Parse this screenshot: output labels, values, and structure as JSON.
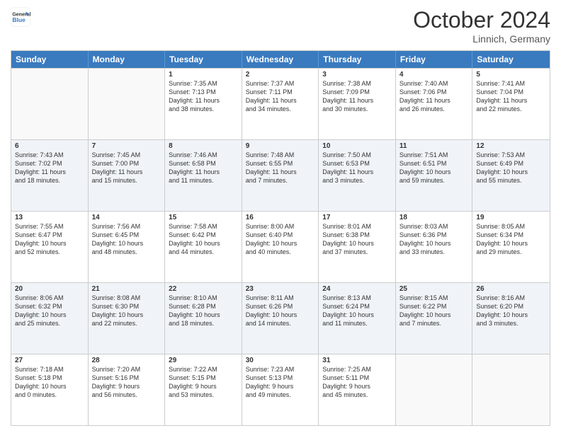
{
  "header": {
    "logo_general": "General",
    "logo_blue": "Blue",
    "month_title": "October 2024",
    "location": "Linnich, Germany"
  },
  "days_of_week": [
    "Sunday",
    "Monday",
    "Tuesday",
    "Wednesday",
    "Thursday",
    "Friday",
    "Saturday"
  ],
  "rows": [
    {
      "alt": false,
      "cells": [
        {
          "day": "",
          "info": ""
        },
        {
          "day": "",
          "info": ""
        },
        {
          "day": "1",
          "info": "Sunrise: 7:35 AM\nSunset: 7:13 PM\nDaylight: 11 hours\nand 38 minutes."
        },
        {
          "day": "2",
          "info": "Sunrise: 7:37 AM\nSunset: 7:11 PM\nDaylight: 11 hours\nand 34 minutes."
        },
        {
          "day": "3",
          "info": "Sunrise: 7:38 AM\nSunset: 7:09 PM\nDaylight: 11 hours\nand 30 minutes."
        },
        {
          "day": "4",
          "info": "Sunrise: 7:40 AM\nSunset: 7:06 PM\nDaylight: 11 hours\nand 26 minutes."
        },
        {
          "day": "5",
          "info": "Sunrise: 7:41 AM\nSunset: 7:04 PM\nDaylight: 11 hours\nand 22 minutes."
        }
      ]
    },
    {
      "alt": true,
      "cells": [
        {
          "day": "6",
          "info": "Sunrise: 7:43 AM\nSunset: 7:02 PM\nDaylight: 11 hours\nand 18 minutes."
        },
        {
          "day": "7",
          "info": "Sunrise: 7:45 AM\nSunset: 7:00 PM\nDaylight: 11 hours\nand 15 minutes."
        },
        {
          "day": "8",
          "info": "Sunrise: 7:46 AM\nSunset: 6:58 PM\nDaylight: 11 hours\nand 11 minutes."
        },
        {
          "day": "9",
          "info": "Sunrise: 7:48 AM\nSunset: 6:55 PM\nDaylight: 11 hours\nand 7 minutes."
        },
        {
          "day": "10",
          "info": "Sunrise: 7:50 AM\nSunset: 6:53 PM\nDaylight: 11 hours\nand 3 minutes."
        },
        {
          "day": "11",
          "info": "Sunrise: 7:51 AM\nSunset: 6:51 PM\nDaylight: 10 hours\nand 59 minutes."
        },
        {
          "day": "12",
          "info": "Sunrise: 7:53 AM\nSunset: 6:49 PM\nDaylight: 10 hours\nand 55 minutes."
        }
      ]
    },
    {
      "alt": false,
      "cells": [
        {
          "day": "13",
          "info": "Sunrise: 7:55 AM\nSunset: 6:47 PM\nDaylight: 10 hours\nand 52 minutes."
        },
        {
          "day": "14",
          "info": "Sunrise: 7:56 AM\nSunset: 6:45 PM\nDaylight: 10 hours\nand 48 minutes."
        },
        {
          "day": "15",
          "info": "Sunrise: 7:58 AM\nSunset: 6:42 PM\nDaylight: 10 hours\nand 44 minutes."
        },
        {
          "day": "16",
          "info": "Sunrise: 8:00 AM\nSunset: 6:40 PM\nDaylight: 10 hours\nand 40 minutes."
        },
        {
          "day": "17",
          "info": "Sunrise: 8:01 AM\nSunset: 6:38 PM\nDaylight: 10 hours\nand 37 minutes."
        },
        {
          "day": "18",
          "info": "Sunrise: 8:03 AM\nSunset: 6:36 PM\nDaylight: 10 hours\nand 33 minutes."
        },
        {
          "day": "19",
          "info": "Sunrise: 8:05 AM\nSunset: 6:34 PM\nDaylight: 10 hours\nand 29 minutes."
        }
      ]
    },
    {
      "alt": true,
      "cells": [
        {
          "day": "20",
          "info": "Sunrise: 8:06 AM\nSunset: 6:32 PM\nDaylight: 10 hours\nand 25 minutes."
        },
        {
          "day": "21",
          "info": "Sunrise: 8:08 AM\nSunset: 6:30 PM\nDaylight: 10 hours\nand 22 minutes."
        },
        {
          "day": "22",
          "info": "Sunrise: 8:10 AM\nSunset: 6:28 PM\nDaylight: 10 hours\nand 18 minutes."
        },
        {
          "day": "23",
          "info": "Sunrise: 8:11 AM\nSunset: 6:26 PM\nDaylight: 10 hours\nand 14 minutes."
        },
        {
          "day": "24",
          "info": "Sunrise: 8:13 AM\nSunset: 6:24 PM\nDaylight: 10 hours\nand 11 minutes."
        },
        {
          "day": "25",
          "info": "Sunrise: 8:15 AM\nSunset: 6:22 PM\nDaylight: 10 hours\nand 7 minutes."
        },
        {
          "day": "26",
          "info": "Sunrise: 8:16 AM\nSunset: 6:20 PM\nDaylight: 10 hours\nand 3 minutes."
        }
      ]
    },
    {
      "alt": false,
      "cells": [
        {
          "day": "27",
          "info": "Sunrise: 7:18 AM\nSunset: 5:18 PM\nDaylight: 10 hours\nand 0 minutes."
        },
        {
          "day": "28",
          "info": "Sunrise: 7:20 AM\nSunset: 5:16 PM\nDaylight: 9 hours\nand 56 minutes."
        },
        {
          "day": "29",
          "info": "Sunrise: 7:22 AM\nSunset: 5:15 PM\nDaylight: 9 hours\nand 53 minutes."
        },
        {
          "day": "30",
          "info": "Sunrise: 7:23 AM\nSunset: 5:13 PM\nDaylight: 9 hours\nand 49 minutes."
        },
        {
          "day": "31",
          "info": "Sunrise: 7:25 AM\nSunset: 5:11 PM\nDaylight: 9 hours\nand 45 minutes."
        },
        {
          "day": "",
          "info": ""
        },
        {
          "day": "",
          "info": ""
        }
      ]
    }
  ]
}
